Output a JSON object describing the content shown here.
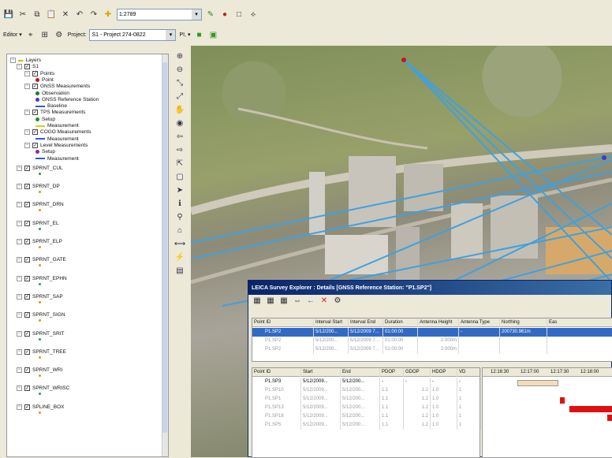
{
  "toolbar1": {
    "scale": "1:2789",
    "icons": [
      "new-icon",
      "open-icon",
      "save-icon",
      "cut-icon",
      "copy-icon",
      "paste-icon",
      "delete-icon",
      "undo-icon",
      "redo-icon",
      "add-data-icon",
      "editor-icon",
      "arcmap-icon",
      "arccatalog-icon",
      "layout-icon",
      "magnify-icon"
    ]
  },
  "toolbar2": {
    "editor_label": "Editor ▾",
    "project_label": "Project:",
    "project_value": "S1 - Project 274-0822",
    "project_extra": "PI, ▾"
  },
  "toc": {
    "root": "Layers",
    "group_s1": "S1",
    "items": [
      {
        "label": "Points",
        "level": 2,
        "kind": "group"
      },
      {
        "label": "Point",
        "level": 3,
        "kind": "dot",
        "color": "#c01818"
      },
      {
        "label": "GNSS Measurements",
        "level": 2,
        "kind": "group"
      },
      {
        "label": "Observation",
        "level": 3,
        "kind": "dot",
        "color": "#1e7a2a"
      },
      {
        "label": "GNSS Reference Station",
        "level": 3,
        "kind": "dot",
        "color": "#3a3ad0"
      },
      {
        "label": "Baseline",
        "level": 3,
        "kind": "line"
      },
      {
        "label": "TPS Measurements",
        "level": 2,
        "kind": "group"
      },
      {
        "label": "Setup",
        "level": 3,
        "kind": "dot",
        "color": "#2a8a2a"
      },
      {
        "label": "Measurement",
        "level": 3,
        "kind": "line",
        "color": "#d0d020"
      },
      {
        "label": "COGO Measurements",
        "level": 2,
        "kind": "group"
      },
      {
        "label": "Measurement",
        "level": 3,
        "kind": "line"
      },
      {
        "label": "Level Measurements",
        "level": 2,
        "kind": "group"
      },
      {
        "label": "Setup",
        "level": 3,
        "kind": "dot",
        "color": "#8a2aa0"
      },
      {
        "label": "Measurement",
        "level": 3,
        "kind": "line"
      }
    ],
    "layers": [
      "SPRNT_CUL",
      "SPRNT_DP",
      "SPRNT_DRN",
      "SPRNT_EL",
      "SPRNT_ELP",
      "SPRNT_GATE",
      "SPRNT_EPHN",
      "SPRNT_SAP",
      "SPRNT_SIGN",
      "SPRNT_SRIT",
      "SPRNT_TREE",
      "SPRNT_WRI",
      "SPRNT_WRISC",
      "SPLINE_BOX"
    ]
  },
  "tools": [
    "zoom-in-icon",
    "zoom-out-icon",
    "fixed-zoom-in-icon",
    "fixed-zoom-out-icon",
    "pan-icon",
    "full-extent-icon",
    "back-icon",
    "forward-icon",
    "select-features-icon",
    "clear-selection-icon",
    "select-elements-icon",
    "identify-icon",
    "find-icon",
    "go-to-xy-icon",
    "measure-icon",
    "hyperlink-icon",
    "html-popup-icon"
  ],
  "explorer": {
    "title": "LEICA Survey Explorer : Details [GNSS Reference Station: \"P1.SP2\"]",
    "columns1": [
      "Point ID",
      "Interval Start",
      "Interval End",
      "Duration",
      "Antenna Height",
      "Antenna Type",
      "Northing",
      "Eas"
    ],
    "rows1": [
      {
        "cells": [
          "P1.SP2",
          "5/12/200...",
          "5/12/2009 7...",
          "01:00:00",
          "",
          "-",
          "200730.961m",
          ""
        ],
        "state": "selected"
      },
      {
        "cells": [
          "P1.SP2",
          "5/12/200...",
          "5/12/2009 7...",
          "01:00:00",
          "2.000m",
          "",
          "",
          ""
        ],
        "state": "dim"
      },
      {
        "cells": [
          "P1.SP2",
          "5/12/200...",
          "5/12/2009 7...",
          "01:00:00",
          "2.000m",
          "",
          "",
          ""
        ],
        "state": "dim"
      }
    ],
    "columns2": [
      "Point ID",
      "Start",
      "End",
      "PDOP",
      "GDOP",
      "HDOP",
      "VD"
    ],
    "rows2": [
      {
        "cells": [
          "P1.SP3",
          "5/12/2009...",
          "5/12/200...",
          "-",
          "-",
          "-",
          "-"
        ],
        "state": "normal"
      },
      {
        "cells": [
          "P1.SP10",
          "5/12/2009...",
          "5/12/200...",
          "1.1",
          "1.2",
          "1.0",
          "1"
        ],
        "state": "dim"
      },
      {
        "cells": [
          "P1.SP1",
          "5/12/2009...",
          "5/12/200...",
          "1.1",
          "1.2",
          "1.0",
          "1"
        ],
        "state": "dim"
      },
      {
        "cells": [
          "P1.SP13",
          "5/12/2009...",
          "5/12/200...",
          "1.1",
          "1.2",
          "1.0",
          "1"
        ],
        "state": "dim"
      },
      {
        "cells": [
          "P1.SP18",
          "5/12/2009...",
          "5/12/200...",
          "1.1",
          "1.2",
          "1.0",
          "1"
        ],
        "state": "dim"
      },
      {
        "cells": [
          "P1.SP5",
          "5/12/2009...",
          "5/12/200...",
          "1.1",
          "1.2",
          "1.0",
          "1"
        ],
        "state": "dim"
      }
    ],
    "gantt_ticks": [
      "12:16:30",
      "12:17:00",
      "12:17:30",
      "12:18:00"
    ]
  }
}
